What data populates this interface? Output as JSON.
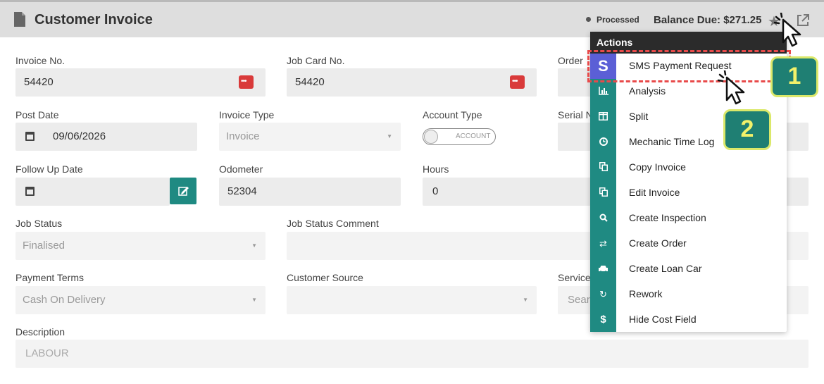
{
  "header": {
    "title": "Customer Invoice",
    "status": "Processed",
    "balance_due": "Balance Due: $271.25"
  },
  "form": {
    "invoice_no": {
      "label": "Invoice No.",
      "value": "54420"
    },
    "job_card_no": {
      "label": "Job Card No.",
      "value": "54420"
    },
    "order": {
      "label": "Order"
    },
    "post_date": {
      "label": "Post Date",
      "value": "09/06/2026"
    },
    "invoice_type": {
      "label": "Invoice Type",
      "value": "Invoice"
    },
    "account_type": {
      "label": "Account Type",
      "toggle_text": "ACCOUNT"
    },
    "serial": {
      "label": "Serial N"
    },
    "follow_up_date": {
      "label": "Follow Up Date",
      "value": ""
    },
    "odometer": {
      "label": "Odometer",
      "value": "52304"
    },
    "hours": {
      "label": "Hours",
      "value": "0"
    },
    "job_status": {
      "label": "Job Status",
      "value": "Finalised"
    },
    "job_status_comment": {
      "label": "Job Status Comment",
      "value": ""
    },
    "payment_terms": {
      "label": "Payment Terms",
      "value": "Cash On Delivery"
    },
    "customer_source": {
      "label": "Customer Source",
      "value": ""
    },
    "service": {
      "label": "Service",
      "placeholder": "Sear"
    },
    "description": {
      "label": "Description",
      "value": "LABOUR"
    }
  },
  "actions_menu": {
    "title": "Actions",
    "items": [
      {
        "label": "SMS Payment Request",
        "icon": "s-logo-icon"
      },
      {
        "label": "Analysis",
        "icon": "bar-chart-icon"
      },
      {
        "label": "Split",
        "icon": "split-columns-icon"
      },
      {
        "label": "Mechanic Time Log",
        "icon": "clock-icon"
      },
      {
        "label": "Copy Invoice",
        "icon": "copy-icon"
      },
      {
        "label": "Edit Invoice",
        "icon": "copy-icon"
      },
      {
        "label": "Create Inspection",
        "icon": "search-icon"
      },
      {
        "label": "Create Order",
        "icon": "swap-arrows-icon"
      },
      {
        "label": "Create Loan Car",
        "icon": "car-icon"
      },
      {
        "label": "Rework",
        "icon": "refresh-icon"
      },
      {
        "label": "Hide Cost Field",
        "icon": "dollar-icon"
      }
    ]
  },
  "annotations": {
    "step1": "1",
    "step2": "2"
  },
  "colors": {
    "accent": "#1f8a82",
    "highlight": "#e84a4a",
    "badge_text": "#f2f16a"
  }
}
